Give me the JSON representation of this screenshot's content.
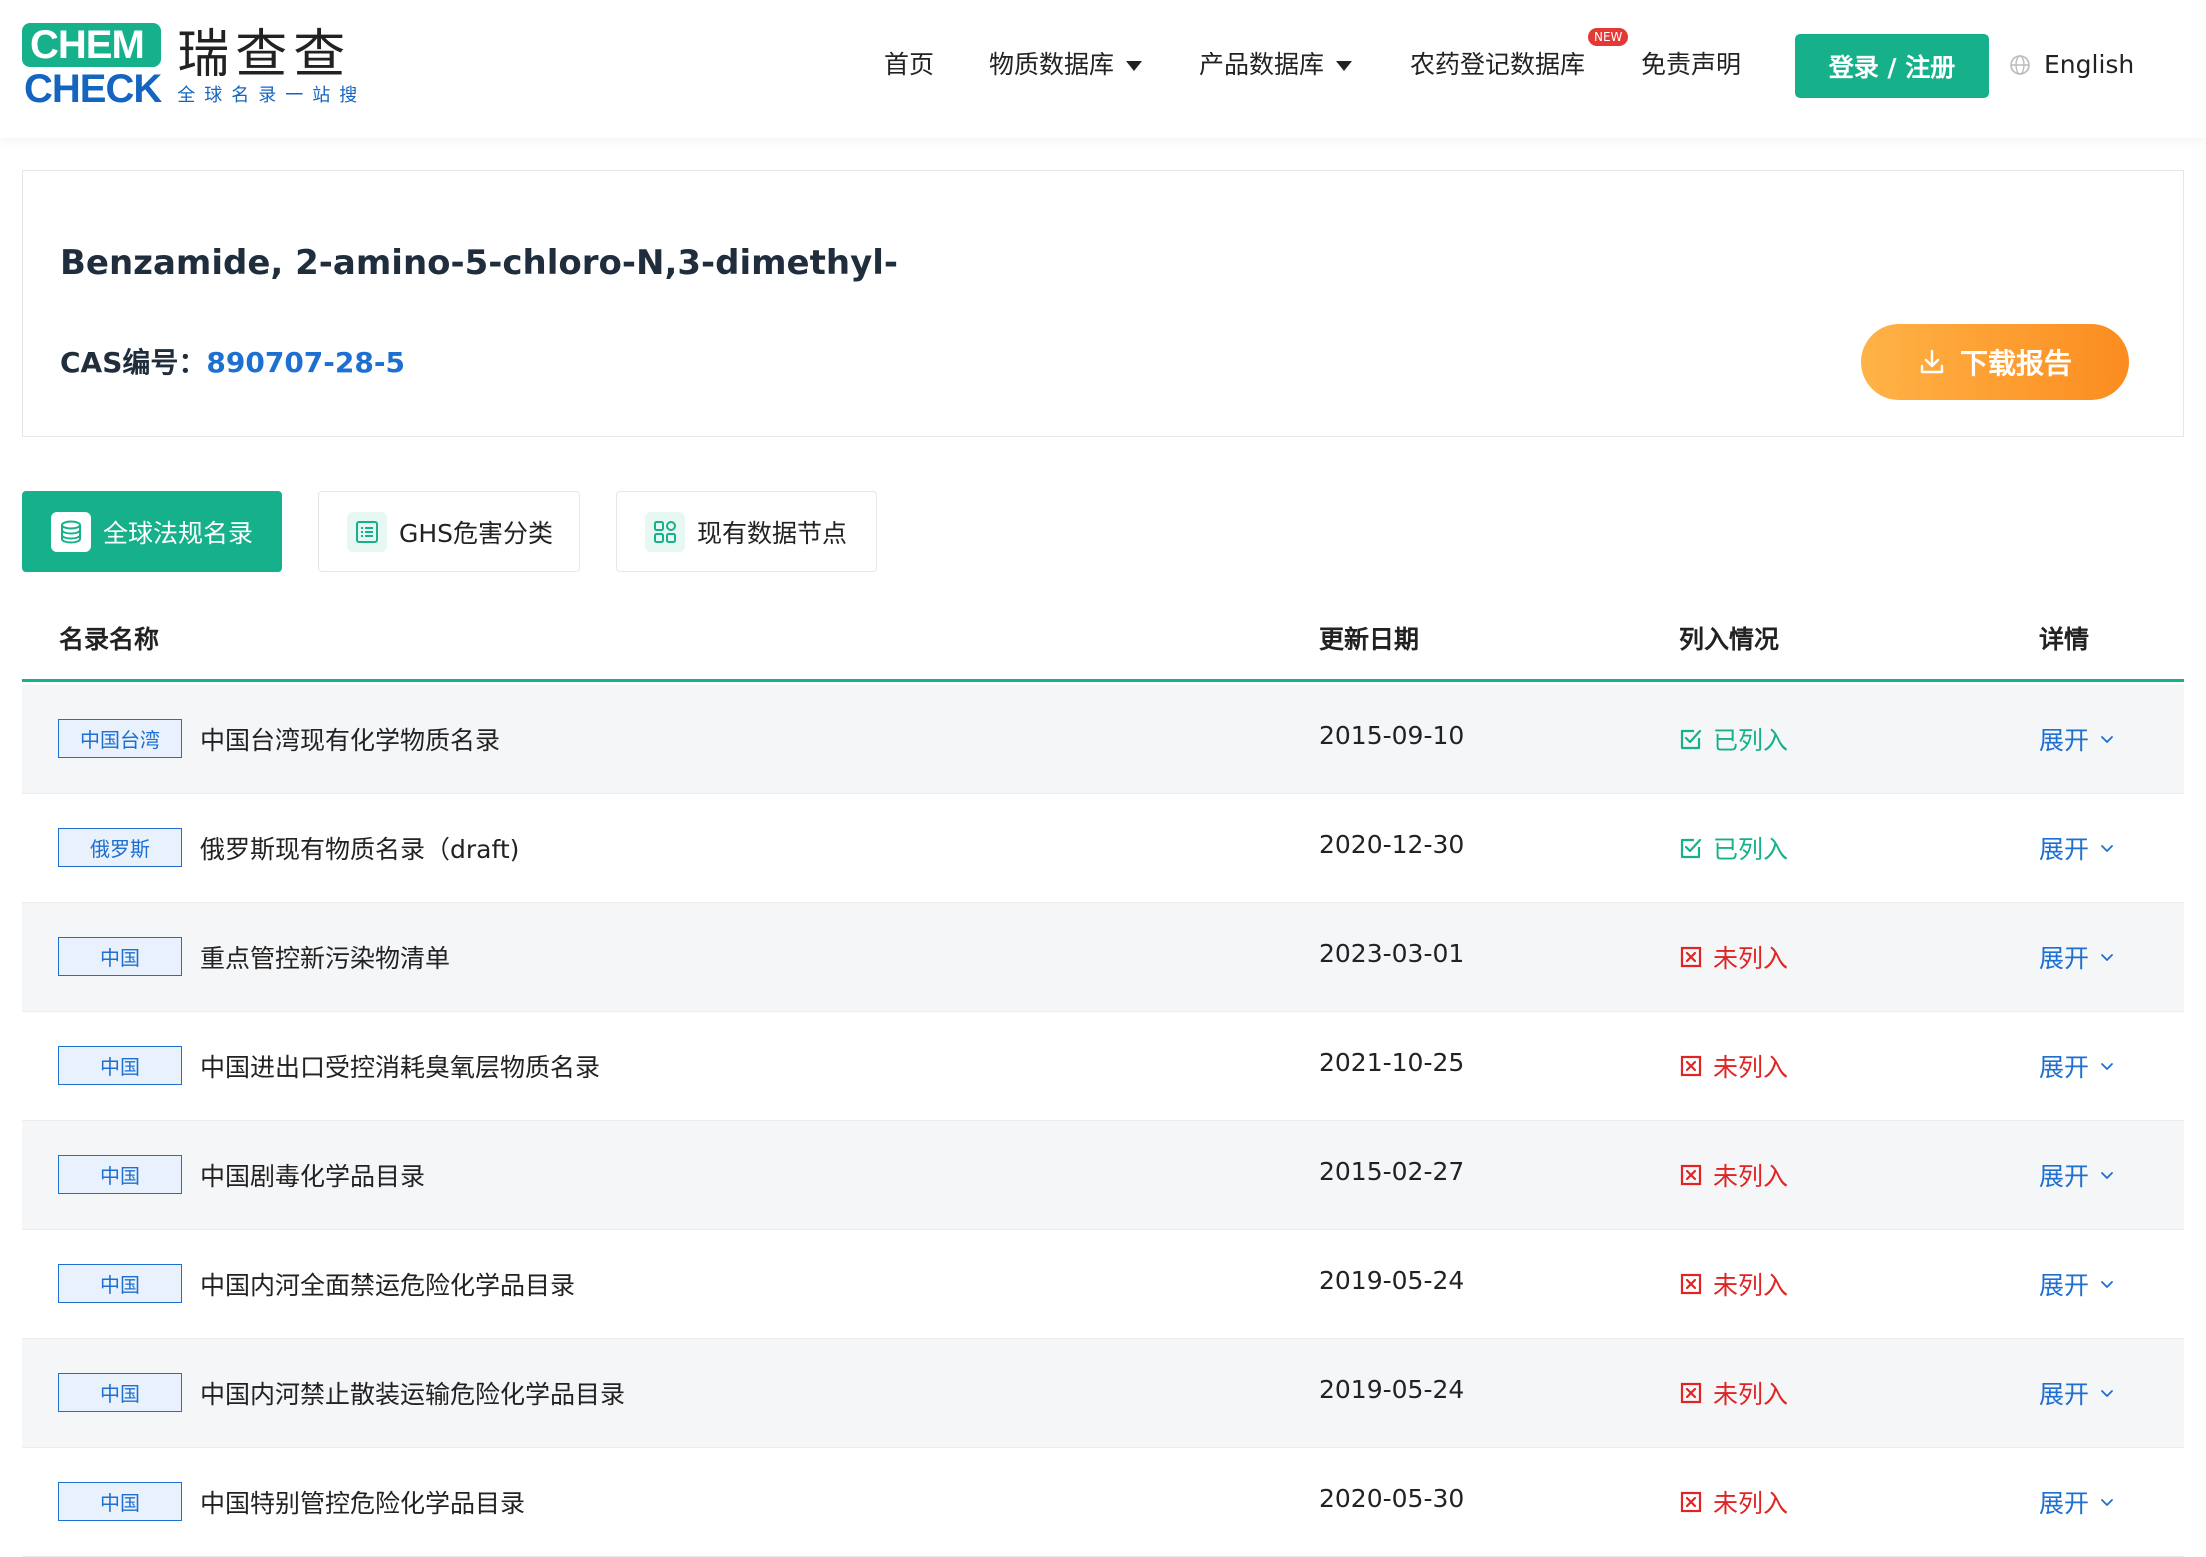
{
  "logo": {
    "mark_top": "CHEM",
    "mark_bottom": "CHECK",
    "name_cn": "瑞查查",
    "slogan": "全球名录一站搜"
  },
  "nav": {
    "home": "首页",
    "substance_db": "物质数据库",
    "product_db": "产品数据库",
    "pesticide_db": "农药登记数据库",
    "new_badge": "NEW",
    "disclaimer": "免责声明",
    "login": "登录 / 注册",
    "language": "English"
  },
  "substance": {
    "name": "Benzamide, 2-amino-5-chloro-N,3-dimethyl-",
    "cas_label": "CAS编号：",
    "cas_value": "890707-28-5",
    "download_label": "下载报告"
  },
  "tabs": [
    {
      "label": "全球法规名录",
      "icon": "database-icon",
      "active": true
    },
    {
      "label": "GHS危害分类",
      "icon": "list-icon",
      "active": false
    },
    {
      "label": "现有数据节点",
      "icon": "grid-icon",
      "active": false
    }
  ],
  "table": {
    "headers": {
      "name": "名录名称",
      "date": "更新日期",
      "status": "列入情况",
      "detail": "详情"
    },
    "expand_label": "展开",
    "rows": [
      {
        "region": "中国台湾",
        "name": "中国台湾现有化学物质名录",
        "date": "2015-09-10",
        "status": "已列入",
        "listed": true
      },
      {
        "region": "俄罗斯",
        "name": "俄罗斯现有物质名录（draft)",
        "date": "2020-12-30",
        "status": "已列入",
        "listed": true
      },
      {
        "region": "中国",
        "name": "重点管控新污染物清单",
        "date": "2023-03-01",
        "status": "未列入",
        "listed": false
      },
      {
        "region": "中国",
        "name": "中国进出口受控消耗臭氧层物质名录",
        "date": "2021-10-25",
        "status": "未列入",
        "listed": false
      },
      {
        "region": "中国",
        "name": "中国剧毒化学品目录",
        "date": "2015-02-27",
        "status": "未列入",
        "listed": false
      },
      {
        "region": "中国",
        "name": "中国内河全面禁运危险化学品目录",
        "date": "2019-05-24",
        "status": "未列入",
        "listed": false
      },
      {
        "region": "中国",
        "name": "中国内河禁止散装运输危险化学品目录",
        "date": "2019-05-24",
        "status": "未列入",
        "listed": false
      },
      {
        "region": "中国",
        "name": "中国特别管控危险化学品目录",
        "date": "2020-05-30",
        "status": "未列入",
        "listed": false
      }
    ]
  },
  "colors": {
    "brand_green": "#16b18b",
    "link_blue": "#1d6fd1",
    "warning_red": "#e02424",
    "download_orange": "#fb8c1f"
  }
}
